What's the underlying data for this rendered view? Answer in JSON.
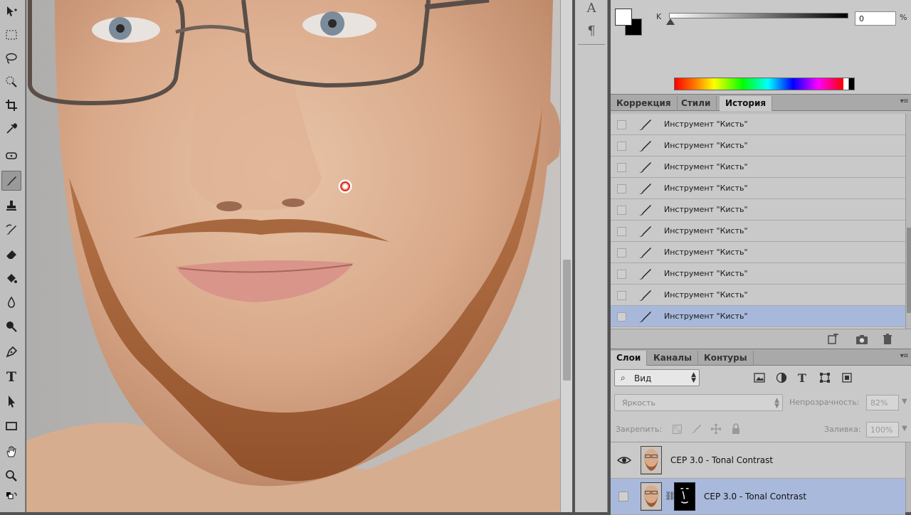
{
  "toolbar": {
    "tools": [
      {
        "name": "move-tool-icon"
      },
      {
        "name": "marquee-tool-icon"
      },
      {
        "name": "lasso-tool-icon"
      },
      {
        "name": "quick-select-tool-icon"
      },
      {
        "name": "crop-tool-icon"
      },
      {
        "name": "eyedropper-tool-icon"
      },
      {
        "name": "healing-brush-tool-icon"
      },
      {
        "name": "brush-tool-icon",
        "active": true
      },
      {
        "name": "clone-stamp-tool-icon"
      },
      {
        "name": "history-brush-tool-icon"
      },
      {
        "name": "eraser-tool-icon"
      },
      {
        "name": "paint-bucket-tool-icon"
      },
      {
        "name": "blur-tool-icon"
      },
      {
        "name": "dodge-tool-icon"
      },
      {
        "name": "pen-tool-icon"
      },
      {
        "name": "type-tool-icon"
      },
      {
        "name": "path-select-tool-icon"
      },
      {
        "name": "rectangle-tool-icon"
      },
      {
        "name": "hand-tool-icon"
      },
      {
        "name": "zoom-tool-icon"
      }
    ]
  },
  "minibar": {
    "icons": [
      "character-panel-icon",
      "paragraph-panel-icon"
    ],
    "character_glyph": "A",
    "paragraph_glyph": "¶"
  },
  "color_panel": {
    "channel_label": "K",
    "channel_value": "0",
    "percent": "%",
    "foreground": "#ffffff",
    "background": "#000000",
    "slider_value_pct": 0
  },
  "history_tabs": {
    "tabs": [
      "Коррекция",
      "Стили",
      "История"
    ],
    "active": "История"
  },
  "history": {
    "items": [
      "Инструмент \"Кисть\"",
      "Инструмент \"Кисть\"",
      "Инструмент \"Кисть\"",
      "Инструмент \"Кисть\"",
      "Инструмент \"Кисть\"",
      "Инструмент \"Кисть\"",
      "Инструмент \"Кисть\"",
      "Инструмент \"Кисть\"",
      "Инструмент \"Кисть\"",
      "Инструмент \"Кисть\""
    ],
    "selected_index": 9,
    "footer_icons": [
      "new-document-from-state-icon",
      "new-snapshot-icon",
      "delete-state-icon"
    ]
  },
  "layers_tabs": {
    "tabs": [
      "Слои",
      "Каналы",
      "Контуры"
    ],
    "active": "Слои"
  },
  "layers": {
    "kind_filter": "Вид",
    "filter_icons": [
      "pixel-filter-icon",
      "adjustment-filter-icon",
      "type-filter-icon",
      "shape-filter-icon",
      "smart-object-filter-icon"
    ],
    "type_glyph": "T",
    "blend_mode": "Яркость",
    "opacity_label": "Непрозрачность:",
    "opacity_value": "82%",
    "lock_label": "Закрепить:",
    "fill_label": "Заливка:",
    "fill_value": "100%",
    "items": [
      {
        "name": "CEP 3.0 - Tonal Contrast",
        "visible": true,
        "selected": false,
        "has_mask": false
      },
      {
        "name": "CEP 3.0 - Tonal Contrast",
        "visible": false,
        "selected": true,
        "has_mask": true
      }
    ]
  },
  "colors": {
    "panel_bg": "#c9c9c9",
    "selection": "#a8b8da",
    "toolbar_bg": "#bfbfbf"
  }
}
